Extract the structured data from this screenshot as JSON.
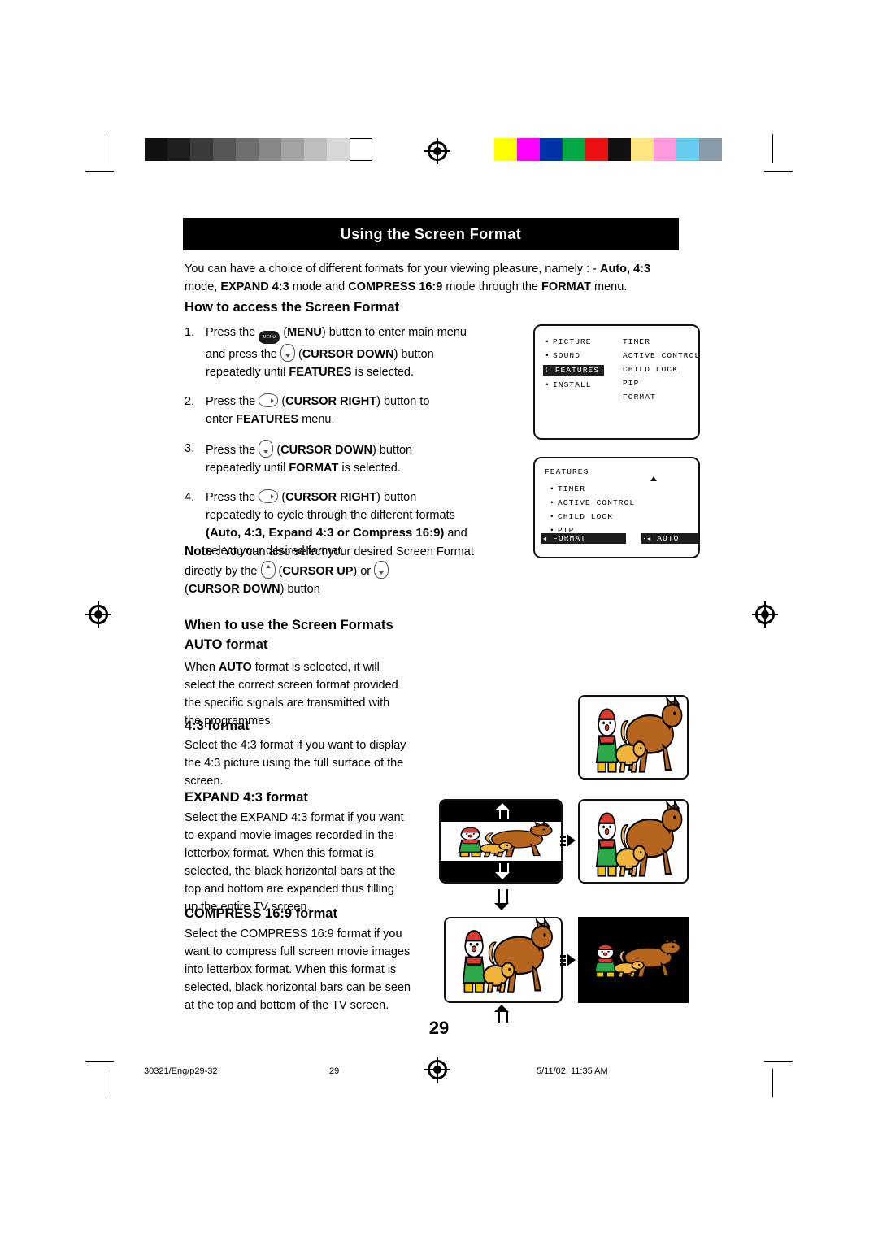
{
  "page": {
    "title": "Using the Screen Format",
    "title_caps_first": "U",
    "number": "29"
  },
  "intro": {
    "line1_a": "You can have a choice of different formats for your viewing pleasure, namely : - ",
    "line1_b": "Auto,  4:3",
    "line2_a": "mode, ",
    "line2_b": "EXPAND 4:3",
    "line2_c": " mode and ",
    "line2_d": "COMPRESS 16:9",
    "line2_e": " mode through the ",
    "line2_f": "FORMAT",
    "line2_g": " menu."
  },
  "sections": {
    "how_to_access": "How to access the Screen Format",
    "when_to_use": "When to use the Screen Formats",
    "auto": "AUTO format",
    "four_three": "4:3 format",
    "expand": "EXPAND 4:3 format",
    "compress": "COMPRESS 16:9 format"
  },
  "steps": [
    {
      "num": "1.",
      "a": "Press the ",
      "icon": "menu-button-icon",
      "b": "(",
      "bold1": "MENU",
      "c": ") button to enter main menu",
      "line2_a": "and press the ",
      "icon2": "cursor-down-icon",
      "line2_b": "(",
      "bold2": "CURSOR DOWN",
      "line2_c": ") button",
      "line3_a": "repeatedly until ",
      "bold3": "FEATURES",
      "line3_b": " is selected."
    },
    {
      "num": "2.",
      "a": "Press the ",
      "icon": "cursor-right-icon",
      "b": "(",
      "bold1": "CURSOR RIGHT",
      "c": ") button to",
      "line2_a": "enter ",
      "bold2": "FEATURES",
      "line2_b": " menu."
    },
    {
      "num": "3.",
      "a": "Press the ",
      "icon": "cursor-down-icon",
      "b": "(",
      "bold1": "CURSOR DOWN",
      "c": ") button",
      "line2_a": "repeatedly until ",
      "bold2": "FORMAT",
      "line2_b": " is selected."
    },
    {
      "num": "4.",
      "a": "Press the ",
      "icon": "cursor-right-icon",
      "b": "(",
      "bold1": "CURSOR RIGHT",
      "c": ") button",
      "line2": "repeatedly to cycle through the different formats",
      "line3_bold": "(Auto, 4:3, Expand 4:3 or Compress 16:9)",
      "line3_rest": " and",
      "line4": "select your desired format."
    }
  ],
  "note": {
    "label": "Note :",
    "text1": "  You can also select your desired Screen Format",
    "text2_a": "directly by the ",
    "icon1": "cursor-up-icon",
    "text2_b": "(",
    "bold1": "CURSOR UP",
    "text2_c": ") or ",
    "icon2": "cursor-down-icon",
    "text3_a": "(",
    "bold2": "CURSOR DOWN",
    "text3_b": ") button"
  },
  "osd_main": {
    "left": [
      "PICTURE",
      "SOUND",
      "FEATURES",
      "INSTALL"
    ],
    "highlighted": "FEATURES",
    "right": [
      "TIMER",
      "ACTIVE CONTROL",
      "CHILD LOCK",
      "PIP",
      "FORMAT"
    ]
  },
  "osd_features": {
    "header": "FEATURES",
    "items": [
      "TIMER",
      "ACTIVE CONTROL",
      "CHILD LOCK",
      "PIP",
      "FORMAT"
    ],
    "highlighted": "FORMAT",
    "value": "AUTO"
  },
  "body": {
    "auto": "When AUTO format is selected, it will\nselect the correct screen format provided\nthe specific signals are transmitted with\nthe programmes.",
    "auto_bold": "AUTO",
    "four_three": "Select the 4:3 format if you want to display\nthe 4:3 picture using the full surface of the\nscreen.",
    "expand": "Select the EXPAND 4:3 format if you want\nto expand movie images recorded in the\nletterbox format. When this format is\nselected, the black horizontal bars at the\ntop and bottom are expanded thus filling\nup the entire TV screen.",
    "compress": "Select the COMPRESS 16:9 format if you\nwant to compress full screen movie images\ninto letterbox format. When this format is\nselected, black horizontal bars can be seen\nat the top and bottom of the TV screen."
  },
  "footer": {
    "left": "30321/Eng/p29-32",
    "center": "29",
    "right": "5/11/02, 11:35 AM"
  },
  "colors": {
    "swatch_grays": [
      "#111111",
      "#222222",
      "#3b3b3b",
      "#555555",
      "#6e6e6e",
      "#888888",
      "#a3a3a3",
      "#bdbdbd",
      "#d8d8d8",
      "#ffffff"
    ],
    "swatch_colors": [
      "#ffff00",
      "#ff00ff",
      "#0033aa",
      "#00aa44",
      "#ee1111",
      "#111111",
      "#ffe680",
      "#ff99dd",
      "#66ccee",
      "#8899aa"
    ]
  }
}
